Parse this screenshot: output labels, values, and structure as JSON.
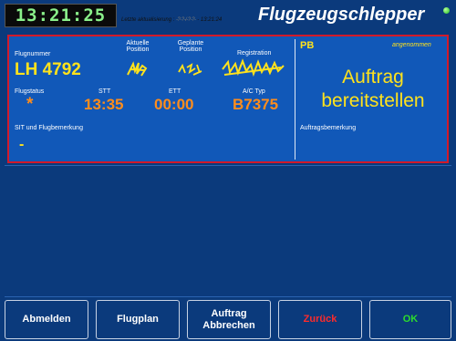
{
  "header": {
    "clock": "13:21:25",
    "last_update_label": "Letzte aktualisierung :",
    "last_update_scribble": "-?-?-/-?-?-",
    "last_update_time": "- 13:21:24",
    "title": "Flugzeugschlepper",
    "status_led_color": "#1fbf1f"
  },
  "flight": {
    "flight_number_label": "Flugnummer",
    "flight_number": "LH 4792",
    "current_position_label_1": "Aktuelle",
    "current_position_label_2": "Position",
    "planned_position_label_1": "Geplante",
    "planned_position_label_2": "Position",
    "registration_label": "Registration",
    "flight_status_label": "Flugstatus",
    "flight_status": "*",
    "stt_label": "STT",
    "stt": "13:35",
    "ett_label": "ETT",
    "ett": "00:00",
    "ac_type_label": "A/C Typ",
    "ac_type": "B7375",
    "sit_label": "SIT und Flugbemerkung",
    "sit_value": "-"
  },
  "order": {
    "pb": "PB",
    "state": "angenommen",
    "text_line1": "Auftrag",
    "text_line2": "bereitstellen",
    "remark_label": "Auftragsbemerkung"
  },
  "buttons": {
    "logout": "Abmelden",
    "flightplan": "Flugplan",
    "cancel_line1": "Auftrag",
    "cancel_line2": "Abbrechen",
    "back": "Zurück",
    "ok": "OK"
  },
  "colors": {
    "background": "#0b3a7c",
    "panel": "#1158b8",
    "panel_border": "#d21a2a",
    "value_yellow": "#ffe21c",
    "value_orange": "#ff8d1c",
    "back_red": "#ff2b2b",
    "ok_green": "#2cdc2c"
  }
}
